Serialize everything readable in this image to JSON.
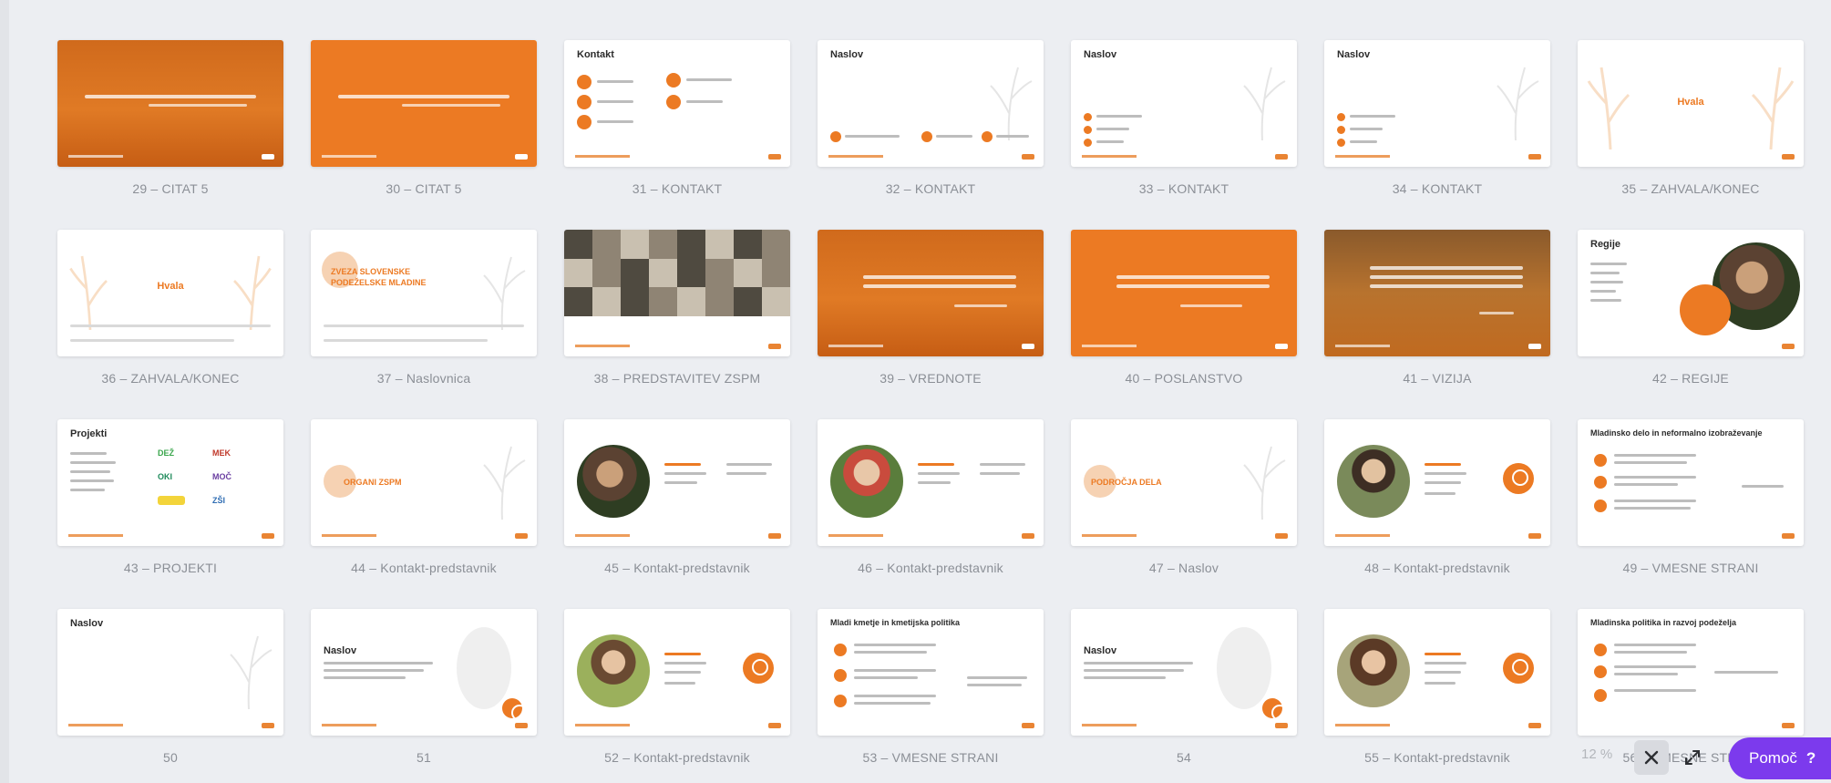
{
  "slides": [
    {
      "caption": "29 – CITAT 5"
    },
    {
      "caption": "30 – CITAT 5"
    },
    {
      "caption": "31 – KONTAKT",
      "title": "Kontakt"
    },
    {
      "caption": "32 – KONTAKT",
      "title": "Naslov"
    },
    {
      "caption": "33 – KONTAKT",
      "title": "Naslov"
    },
    {
      "caption": "34 – KONTAKT",
      "title": "Naslov"
    },
    {
      "caption": "35 – ZAHVALA/KONEC",
      "title": "Hvala"
    },
    {
      "caption": "36 – ZAHVALA/KONEC",
      "title": "Hvala"
    },
    {
      "caption": "37 – Naslovnica",
      "title": "ZVEZA SLOVENSKE PODEŽELSKE MLADINE"
    },
    {
      "caption": "38 – PREDSTAVITEV ZSPM"
    },
    {
      "caption": "39 – VREDNOTE"
    },
    {
      "caption": "40 – POSLANSTVO"
    },
    {
      "caption": "41 – VIZIJA"
    },
    {
      "caption": "42 – REGIJE",
      "title": "Regije"
    },
    {
      "caption": "43 – PROJEKTI",
      "title": "Projekti",
      "projects": [
        "DEŽ",
        "MEK",
        "OKI",
        "MOČ",
        "ZŠI"
      ]
    },
    {
      "caption": "44 – Kontakt-predstavnik",
      "title": "ORGANI ZSPM"
    },
    {
      "caption": "45 – Kontakt-predstavnik"
    },
    {
      "caption": "46 – Kontakt-predstavnik"
    },
    {
      "caption": "47 – Naslov",
      "title": "PODROČJA DELA"
    },
    {
      "caption": "48 – Kontakt-predstavnik"
    },
    {
      "caption": "49 – VMESNE STRANI",
      "title": "Mladinsko delo in neformalno izobraževanje"
    },
    {
      "caption": "50",
      "title": "Naslov"
    },
    {
      "caption": "51",
      "title": "Naslov"
    },
    {
      "caption": "52 – Kontakt-predstavnik"
    },
    {
      "caption": "53 – VMESNE STRANI",
      "title": "Mladi kmetje in kmetijska politika"
    },
    {
      "caption": "54",
      "title": "Naslov"
    },
    {
      "caption": "55 – Kontakt-predstavnik"
    },
    {
      "caption": "56 – VMESNE STRANI",
      "title": "Mladinska politika in razvoj podeželja"
    }
  ],
  "footer": {
    "zoom": "12 %",
    "close_icon": "close-icon",
    "expand_icon": "expand-icon",
    "help_label": "Pomoč",
    "help_mark": "?"
  },
  "colors": {
    "accent": "#ec7a23",
    "help": "#7c3aed",
    "background": "#eceef2"
  }
}
